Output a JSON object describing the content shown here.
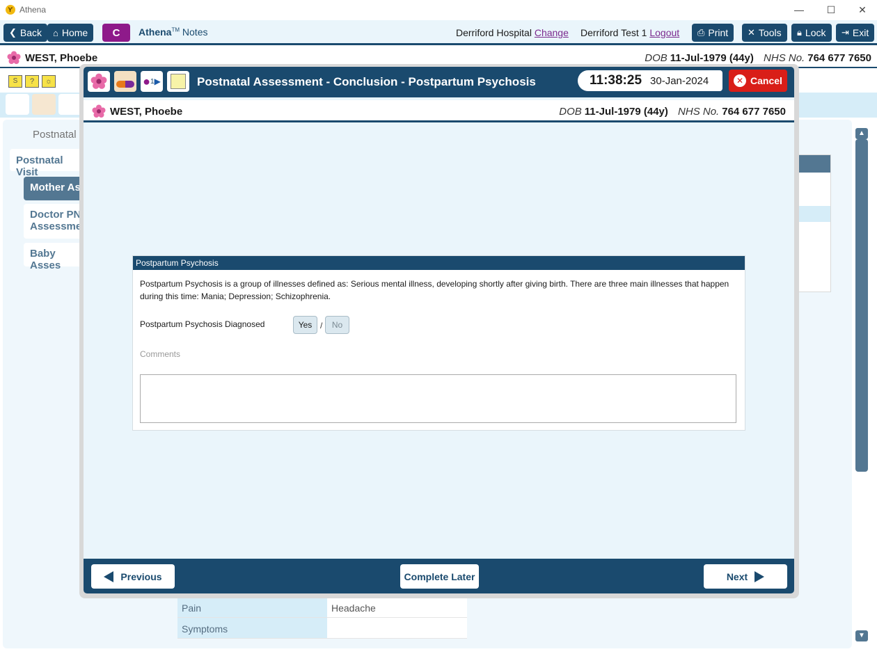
{
  "window": {
    "app_title": "Athena"
  },
  "toolbar": {
    "back": "Back",
    "home": "Home",
    "c_button": "C",
    "brand_name": "Athena",
    "brand_tm": "TM",
    "brand_suffix": "Notes",
    "hospital": "Derriford Hospital",
    "change": "Change",
    "user": "Derriford Test 1",
    "logout": "Logout",
    "print": "Print",
    "tools": "Tools",
    "lock": "Lock",
    "exit": "Exit"
  },
  "patient": {
    "name": "WEST, Phoebe",
    "dob_label": "DOB",
    "dob": "11-Jul-1979 (44y)",
    "nhs_label": "NHS No.",
    "nhs": "764 677 7650"
  },
  "background": {
    "heading": "Postnatal",
    "tab": "Postnatal Visit",
    "nav": [
      "Mother Ass",
      "Doctor PN Assessmen",
      "Baby Asses"
    ],
    "table": [
      {
        "key": "Pain",
        "value": "Headache"
      },
      {
        "key": "Symptoms",
        "value": ""
      }
    ]
  },
  "modal": {
    "title": "Postnatal Assessment - Conclusion - Postpartum Psychosis",
    "time": "11:38:25",
    "date": "30-Jan-2024",
    "cancel": "Cancel",
    "icon_badge": "1",
    "panel": {
      "heading": "Postpartum Psychosis",
      "description": "Postpartum Psychosis is a group of illnesses defined as: Serious mental illness, developing shortly after giving birth. There are three main illnesses that happen during this time: Mania; Depression; Schizophrenia.",
      "diagnosed_label": "Postpartum Psychosis Diagnosed",
      "yes": "Yes",
      "separator": "/",
      "no": "No",
      "comments_label": "Comments",
      "comments_value": ""
    },
    "footer": {
      "previous": "Previous",
      "complete_later": "Complete Later",
      "next": "Next"
    }
  }
}
